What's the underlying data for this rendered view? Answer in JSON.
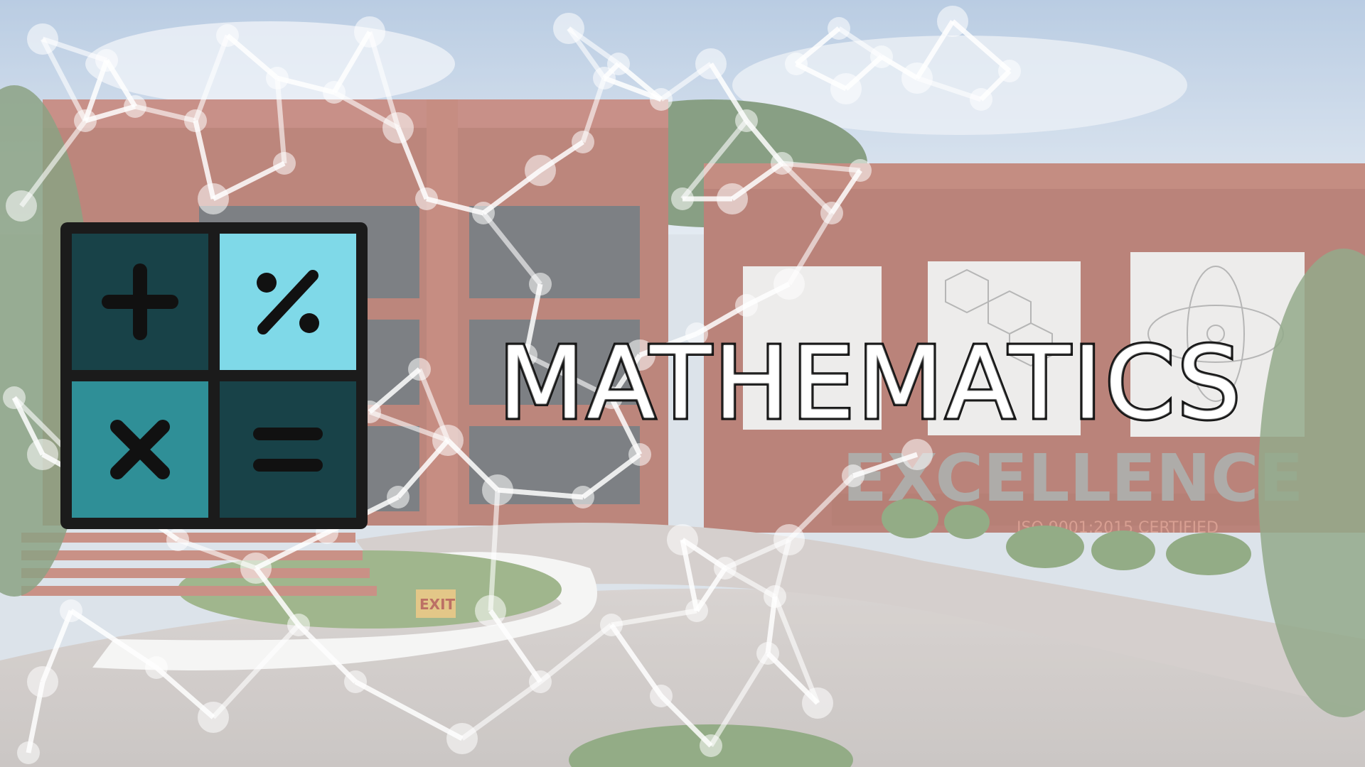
{
  "banner": {
    "title": "MATHEMATICS",
    "sign_text": "EXCELLENCE",
    "certification_text": "ISO 9001:2015 CERTIFIED",
    "exit_sign": "EXIT"
  },
  "calculator_icon": {
    "keys": [
      "+",
      "%",
      "×",
      "="
    ],
    "colors": {
      "frame": "#1b1b1b",
      "dark": "#184248",
      "light": "#7fd9e8",
      "teal": "#2f8f97"
    }
  },
  "colors": {
    "sky": "#b8cde4",
    "brick": "#a3584a",
    "pavement": "#cdc6c4",
    "foliage": "#6f8f64",
    "haze_overlay": "#ffffff",
    "molecule": "#ffffff"
  }
}
